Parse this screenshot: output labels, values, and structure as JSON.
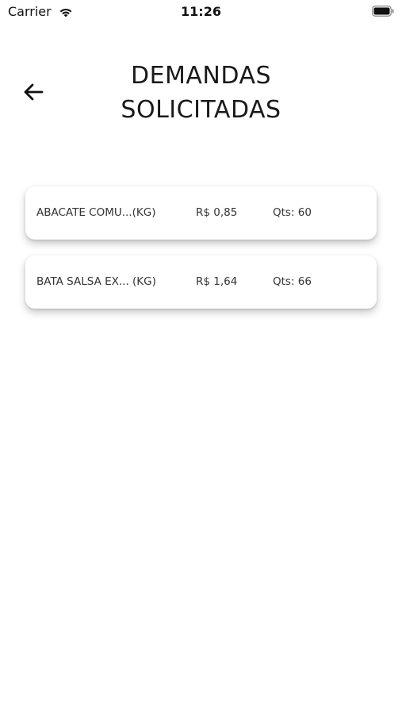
{
  "status_bar": {
    "carrier": "Carrier",
    "time": "11:26",
    "wifi_icon": "wifi-icon",
    "battery_icon": "battery-icon"
  },
  "header": {
    "back_icon": "arrow-left-icon",
    "title_line1": "DEMANDAS",
    "title_line2": "SOLICITADAS"
  },
  "demands": [
    {
      "name": "ABACATE COMU...(KG)",
      "price": "R$ 0,85",
      "qty": "Qts: 60"
    },
    {
      "name": "BATA SALSA EX... (KG)",
      "price": "R$ 1,64",
      "qty": "Qts: 66"
    }
  ],
  "colors": {
    "background": "#ffffff",
    "text": "#333333",
    "title": "#1a1a1a"
  }
}
